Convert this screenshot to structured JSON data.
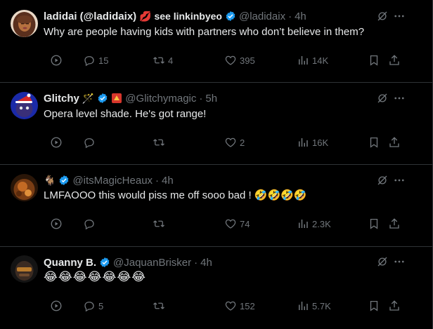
{
  "colors": {
    "background": "#000000",
    "text": "#e7e9ea",
    "muted": "#71767b",
    "divider": "#2f3336",
    "verified": "#1d9bf0"
  },
  "icons": {
    "play": "play-circle-icon",
    "reply": "reply-icon",
    "retweet": "retweet-icon",
    "like": "heart-icon",
    "views": "views-bar-chart-icon",
    "bookmark": "bookmark-icon",
    "share": "share-icon",
    "grok": "grok-icon",
    "more": "more-dots-icon",
    "verified": "verified-badge-icon"
  },
  "tweets": [
    {
      "name": "ladidai (@ladidaix)",
      "name_suffix": "💋 see linkinbyeo",
      "handle": "@ladidaix",
      "time": "4h",
      "text": "Why are people having kids with partners who don’t believe in them?",
      "replies": "15",
      "retweets": "4",
      "likes": "395",
      "views": "14K"
    },
    {
      "name": "Glitchy",
      "name_emoji": "🪄",
      "handle": "@Glitchymagic",
      "time": "5h",
      "text": "Opera level shade. He's got range!",
      "replies": "",
      "retweets": "",
      "likes": "2",
      "views": "16K"
    },
    {
      "name_emoji": "🐐",
      "handle": "@itsMagicHeaux",
      "time": "4h",
      "text": "LMFAOOO this would piss me off sooo bad ! 🤣🤣🤣🤣",
      "replies": "",
      "retweets": "",
      "likes": "74",
      "views": "2.3K"
    },
    {
      "name": "Quanny B.",
      "handle": "@JaquanBrisker",
      "time": "4h",
      "text": "😂😂😂😂😂😂😂",
      "replies": "5",
      "retweets": "",
      "likes": "152",
      "views": "5.7K"
    }
  ]
}
